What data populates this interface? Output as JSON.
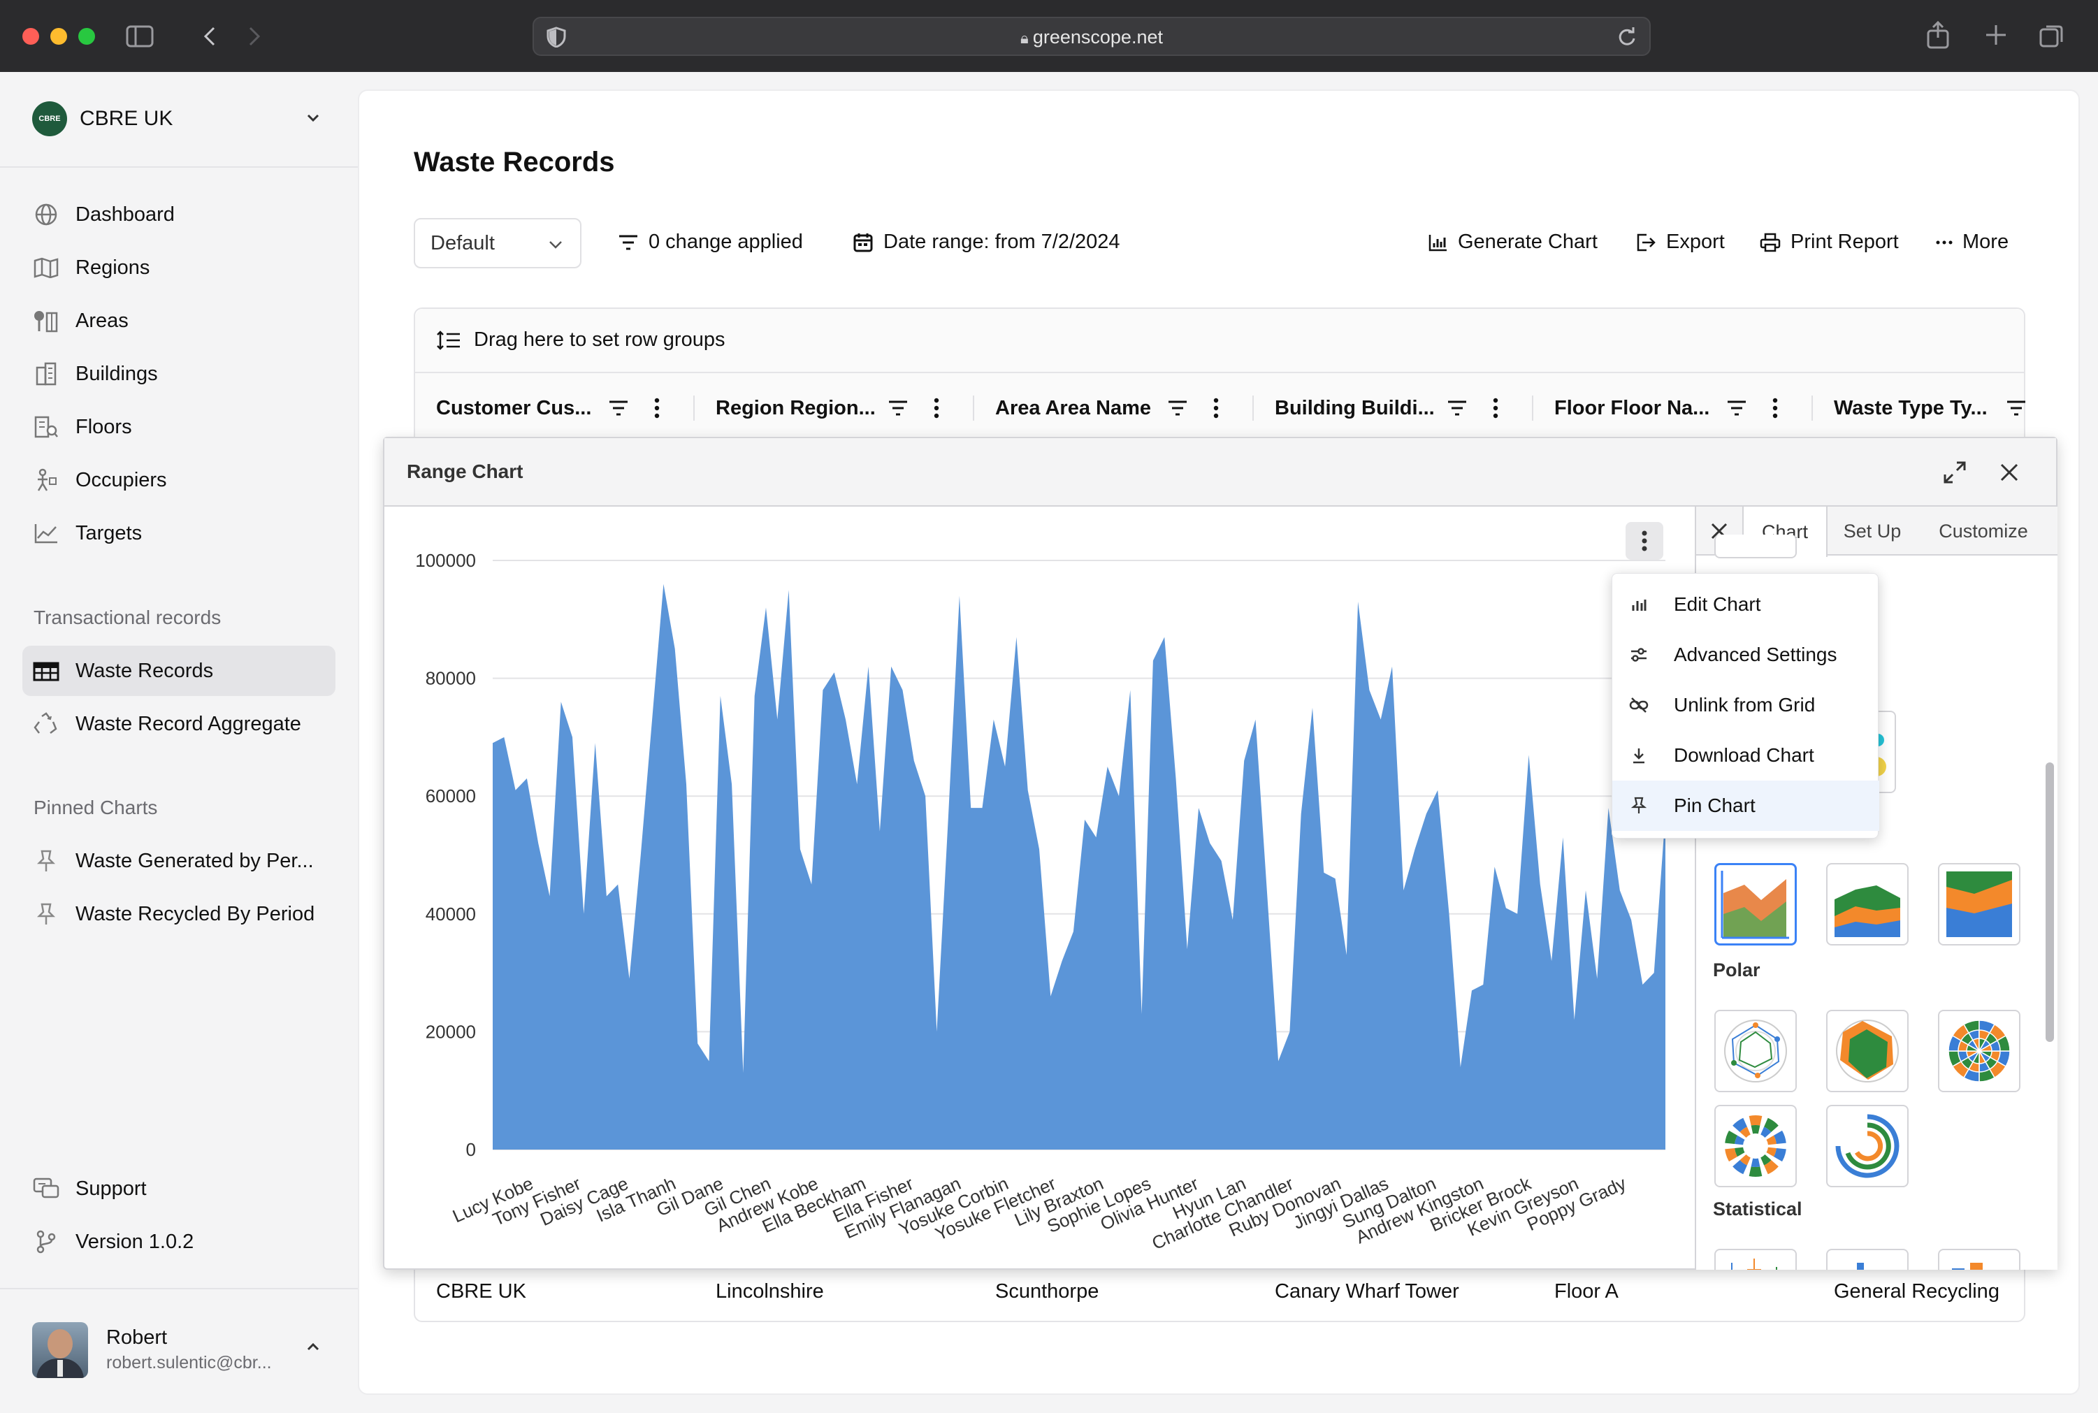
{
  "browser": {
    "url": "greenscope.net"
  },
  "org": {
    "name": "CBRE UK",
    "logo_text": "CBRE"
  },
  "nav": {
    "main": [
      {
        "label": "Dashboard",
        "icon": "globe-icon"
      },
      {
        "label": "Regions",
        "icon": "map-icon"
      },
      {
        "label": "Areas",
        "icon": "trees-icon"
      },
      {
        "label": "Buildings",
        "icon": "building-icon"
      },
      {
        "label": "Floors",
        "icon": "floor-search-icon"
      },
      {
        "label": "Occupiers",
        "icon": "person-icon"
      },
      {
        "label": "Targets",
        "icon": "line-chart-icon"
      }
    ],
    "transactional_title": "Transactional records",
    "transactional": [
      {
        "label": "Waste Records",
        "icon": "table-icon",
        "active": true
      },
      {
        "label": "Waste Record Aggregate",
        "icon": "recycle-icon"
      }
    ],
    "pinned_title": "Pinned Charts",
    "pinned": [
      {
        "label": "Waste Generated by Per...",
        "icon": "pin-icon"
      },
      {
        "label": "Waste Recycled By Period",
        "icon": "pin-icon"
      }
    ],
    "support": "Support",
    "version": "Version 1.0.2"
  },
  "user": {
    "name": "Robert",
    "email": "robert.sulentic@cbr..."
  },
  "page": {
    "title": "Waste Records"
  },
  "toolbar": {
    "view_select": "Default",
    "changes": "0 change applied",
    "date_range": "Date range: from 7/2/2024",
    "generate_chart": "Generate Chart",
    "export": "Export",
    "print_report": "Print Report",
    "more": "More"
  },
  "grid": {
    "row_group_hint": "Drag here to set row groups",
    "columns": [
      "Customer Cus...",
      "Region Region...",
      "Area Area Name",
      "Building Buildi...",
      "Floor Floor Na...",
      "Waste Type Ty..."
    ],
    "visible_row": [
      "CBRE UK",
      "Lincolnshire",
      "Scunthorpe",
      "Canary Wharf Tower",
      "Floor A",
      "General Recycling"
    ]
  },
  "chart_window": {
    "title": "Range Chart",
    "tabs": [
      "Chart",
      "Set Up",
      "Customize"
    ],
    "active_tab": "Chart",
    "groups": [
      "Polar",
      "Statistical"
    ],
    "menu": [
      {
        "label": "Edit Chart",
        "icon": "bar-chart-icon"
      },
      {
        "label": "Advanced Settings",
        "icon": "settings-sliders-icon"
      },
      {
        "label": "Unlink from Grid",
        "icon": "unlink-icon"
      },
      {
        "label": "Download Chart",
        "icon": "download-icon"
      },
      {
        "label": "Pin Chart",
        "icon": "pin-icon",
        "highlighted": true
      }
    ]
  },
  "chart_data": {
    "type": "area",
    "color": "#5b95d8",
    "ylim": [
      0,
      100000
    ],
    "yticks": [
      0,
      20000,
      40000,
      60000,
      80000,
      100000
    ],
    "grid": true,
    "x_tick_labels": [
      "Lucy Kobe",
      "Tony Fisher",
      "Daisy Cage",
      "Isla Thanh",
      "Gil Dane",
      "Gil Chen",
      "Andrew Kobe",
      "Ella Beckham",
      "Ella Fisher",
      "Emily Flanagan",
      "Yosuke Corbin",
      "Yosuke Fletcher",
      "Lily Braxton",
      "Sophie Lopes",
      "Olivia Hunter",
      "Hyun Lan",
      "Charlotte Chandler",
      "Ruby Donovan",
      "Jingyi Dallas",
      "Sung Dalton",
      "Andrew Kingston",
      "Bricker Brock",
      "Kevin Greyson",
      "Poppy Grady"
    ],
    "values": [
      69000,
      70000,
      61000,
      63000,
      52000,
      43000,
      76000,
      70000,
      40000,
      69000,
      43000,
      45000,
      29000,
      50000,
      73000,
      96000,
      85000,
      62000,
      18000,
      15000,
      77000,
      62000,
      13000,
      77000,
      92000,
      73000,
      95000,
      51000,
      45000,
      78000,
      81000,
      73000,
      62000,
      82000,
      54000,
      82000,
      78000,
      66000,
      60000,
      20000,
      56000,
      94000,
      58000,
      58000,
      73000,
      65000,
      87000,
      61000,
      51000,
      26000,
      32000,
      37000,
      56000,
      53000,
      65000,
      60000,
      78000,
      23000,
      83000,
      87000,
      63000,
      34000,
      58000,
      52000,
      49000,
      39000,
      66000,
      73000,
      44000,
      15000,
      20000,
      57000,
      75000,
      47000,
      46000,
      33000,
      93000,
      78000,
      73000,
      82000,
      44000,
      51000,
      57000,
      61000,
      40000,
      14000,
      27000,
      28000,
      48000,
      41000,
      40000,
      67000,
      45000,
      32000,
      53000,
      22000,
      44000,
      29000,
      58000,
      44000,
      39000,
      28000,
      30000,
      57000
    ]
  }
}
